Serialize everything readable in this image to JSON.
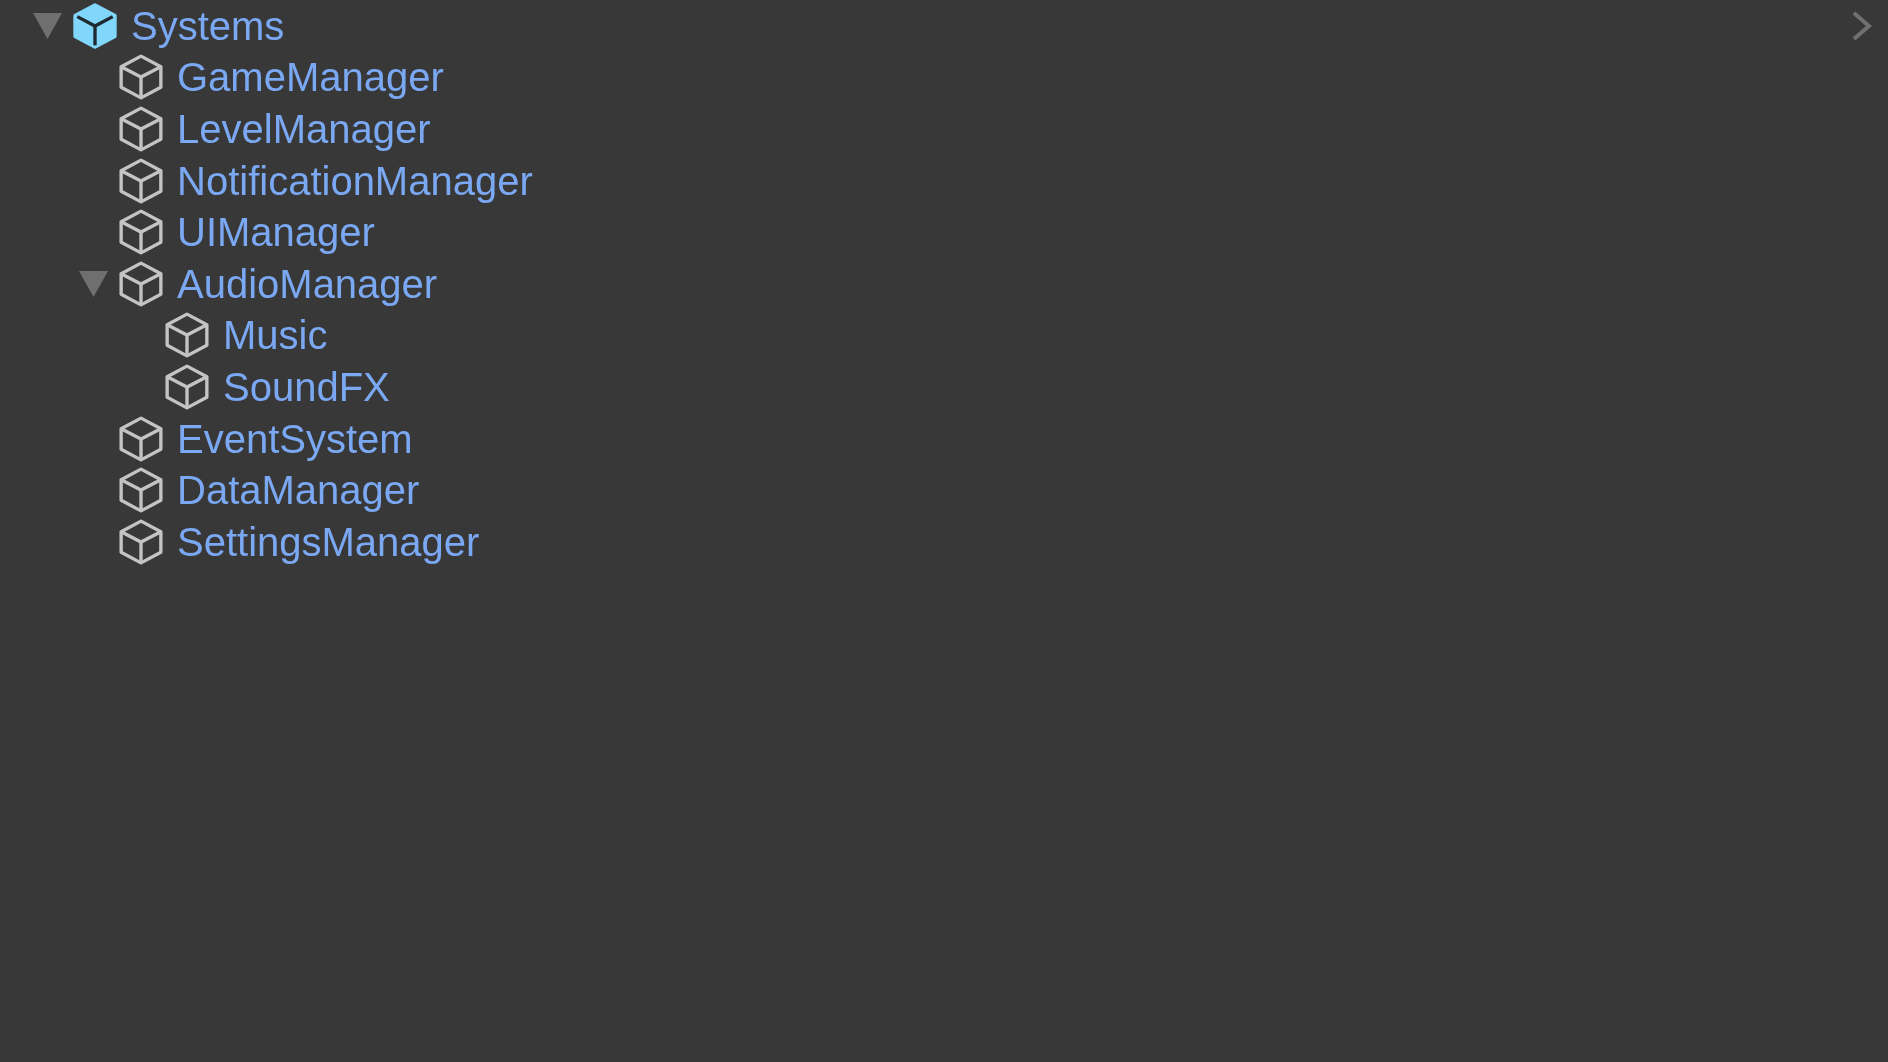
{
  "hierarchy": {
    "items": [
      {
        "name": "Systems",
        "kind": "prefab",
        "expanded": true,
        "children": [
          {
            "name": "GameManager",
            "kind": "object"
          },
          {
            "name": "LevelManager",
            "kind": "object"
          },
          {
            "name": "NotificationManager",
            "kind": "object"
          },
          {
            "name": "UIManager",
            "kind": "object"
          },
          {
            "name": "AudioManager",
            "kind": "object",
            "expanded": true,
            "children": [
              {
                "name": "Music",
                "kind": "object"
              },
              {
                "name": "SoundFX",
                "kind": "object"
              }
            ]
          },
          {
            "name": "EventSystem",
            "kind": "object"
          },
          {
            "name": "DataManager",
            "kind": "object"
          },
          {
            "name": "SettingsManager",
            "kind": "object"
          }
        ]
      }
    ]
  }
}
